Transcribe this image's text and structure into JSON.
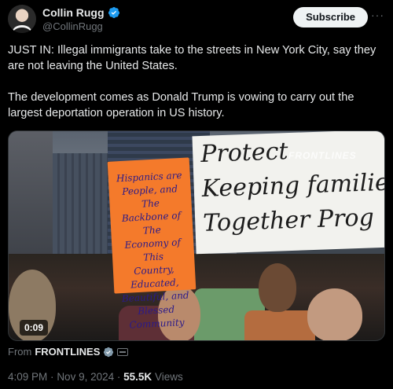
{
  "author": {
    "display_name": "Collin Rugg",
    "handle": "@CollinRugg"
  },
  "header": {
    "subscribe_label": "Subscribe",
    "more_label": "···"
  },
  "tweet": {
    "paragraph_1": "JUST IN: Illegal immigrants take to the streets in New York City, say they are not leaving the United States.",
    "paragraph_2": "The development comes as Donald Trump is vowing to carry out the largest deportation operation in US history."
  },
  "media": {
    "duration": "0:09",
    "watermark": "FRONTLINES",
    "sign_white_lines": [
      "Protect",
      "Keeping families",
      "Together Prog"
    ],
    "sign_orange_lines": [
      "Hispanics are",
      "People, and The",
      "Backbone of The",
      "Economy of This",
      "Country, Educated,",
      "Beautiful, and Blessed",
      "Community"
    ]
  },
  "attribution": {
    "prefix": "From",
    "source": "FRONTLINES"
  },
  "meta": {
    "time": "4:09 PM",
    "separator": "·",
    "date": "Nov 9, 2024",
    "views_count": "55.5K",
    "views_label": "Views"
  },
  "colors": {
    "verified_blue": "#1d9bf0",
    "gov_gray": "#829aab"
  },
  "icons": {
    "verified": "verified-badge-icon",
    "gov": "gov-badge-icon",
    "affiliate": "affiliate-badge-icon",
    "more": "more-icon"
  }
}
